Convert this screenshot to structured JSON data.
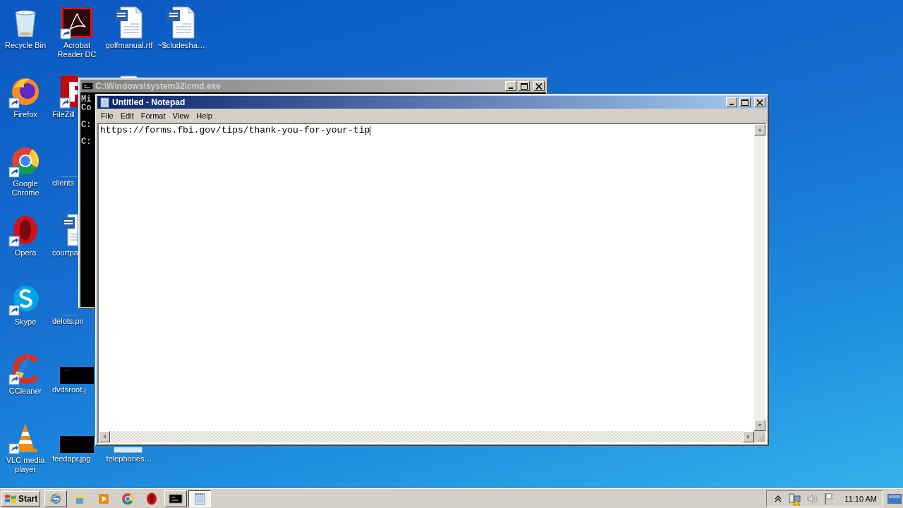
{
  "desktop": {
    "columns": [
      [
        {
          "label": "Recycle Bin",
          "kind": "recycle",
          "shortcut": false
        },
        {
          "label": "Firefox",
          "kind": "firefox",
          "shortcut": true
        },
        {
          "label": "Google Chrome",
          "kind": "chrome",
          "shortcut": true
        },
        {
          "label": "Opera",
          "kind": "opera",
          "shortcut": true
        },
        {
          "label": "Skype",
          "kind": "skype",
          "shortcut": true
        },
        {
          "label": "CCleaner",
          "kind": "ccleaner",
          "shortcut": true
        },
        {
          "label": "VLC media player",
          "kind": "vlc",
          "shortcut": true
        }
      ],
      [
        {
          "label": "Acrobat Reader DC",
          "kind": "acrobat",
          "shortcut": true
        },
        {
          "label": "FileZill",
          "kind": "filezilla",
          "shortcut": true
        },
        {
          "label": "clients",
          "kind": "line",
          "shortcut": false
        },
        {
          "label": "courtpa",
          "kind": "word",
          "shortcut": false
        },
        {
          "label": "delots.pn",
          "kind": "line",
          "shortcut": false
        },
        {
          "label": "dvdsroot.j",
          "kind": "image",
          "shortcut": false
        },
        {
          "label": "feedapr.jpg",
          "kind": "image",
          "shortcut": false
        }
      ],
      [
        {
          "label": "golfmanual.rtf",
          "kind": "word",
          "shortcut": false
        },
        {
          "kind": "word"
        },
        {
          "label": "telephones…",
          "kind": "image_light",
          "shortcut": false
        }
      ],
      [
        {
          "label": "~$cludesha…",
          "kind": "word",
          "shortcut": false
        }
      ]
    ]
  },
  "cmd_window": {
    "title": "C:\\Windows\\system32\\cmd.exe",
    "active": false,
    "lines": [
      "Mi",
      "Co",
      "C:",
      "C:"
    ]
  },
  "notepad_window": {
    "title": "Untitled - Notepad",
    "active": true,
    "menu": [
      "File",
      "Edit",
      "Format",
      "View",
      "Help"
    ],
    "text": "https://forms.fbi.gov/tips/thank-you-for-your-tip"
  },
  "taskbar": {
    "start": "Start",
    "buttons": [
      {
        "kind": "ie",
        "running": true,
        "selected": false
      },
      {
        "kind": "explorer",
        "running": false,
        "selected": false
      },
      {
        "kind": "media",
        "running": false,
        "selected": false
      },
      {
        "kind": "chrome",
        "running": false,
        "selected": false
      },
      {
        "kind": "opera",
        "running": false,
        "selected": false
      },
      {
        "kind": "cmd",
        "running": true,
        "selected": false
      },
      {
        "kind": "notepad",
        "running": true,
        "selected": true
      }
    ],
    "tray": {
      "icons": [
        {
          "kind": "chevron"
        },
        {
          "kind": "network"
        },
        {
          "kind": "volume"
        },
        {
          "kind": "flag"
        }
      ],
      "time": "11:10 AM"
    }
  }
}
